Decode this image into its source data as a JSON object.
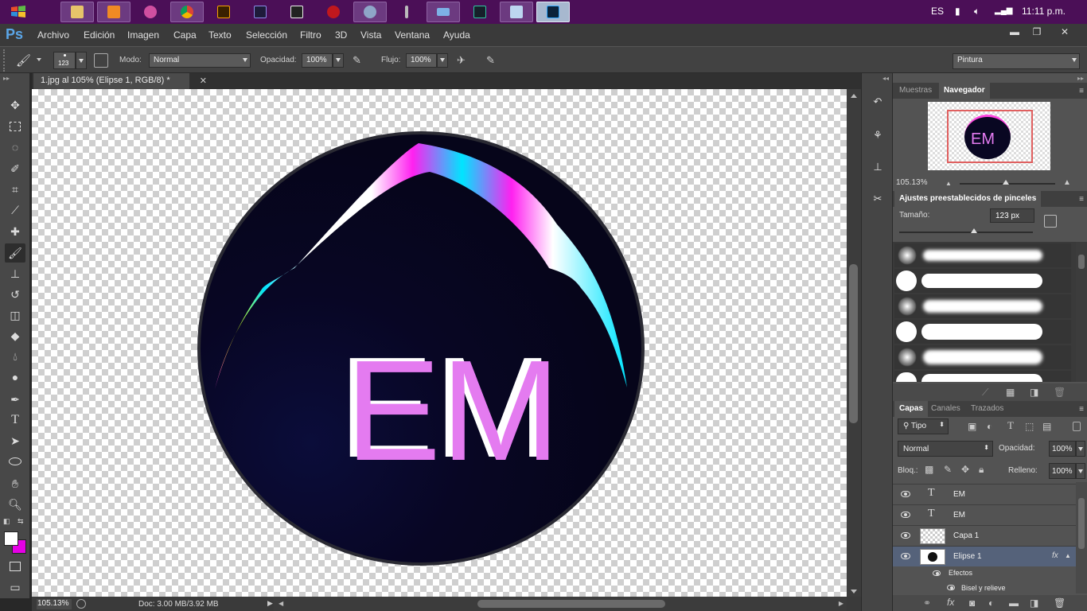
{
  "taskbar": {
    "apps": [
      {
        "name": "file-explorer",
        "active": true
      },
      {
        "name": "media-player",
        "active": true
      },
      {
        "name": "paint-app",
        "active": false
      },
      {
        "name": "chrome",
        "active": true
      },
      {
        "name": "illustrator",
        "active": false
      },
      {
        "name": "premiere",
        "active": false
      },
      {
        "name": "cs-game",
        "active": false
      },
      {
        "name": "music-player",
        "active": false
      },
      {
        "name": "paint-palette",
        "active": true
      },
      {
        "name": "pen-tool-app",
        "active": false
      },
      {
        "name": "keyboard",
        "active": true
      },
      {
        "name": "video-editor",
        "active": false
      },
      {
        "name": "notepad",
        "active": true
      },
      {
        "name": "photoshop",
        "active": true
      }
    ],
    "language": "ES",
    "clock": "11:11 p.m."
  },
  "menubar": {
    "logo": "Ps",
    "items": [
      "Archivo",
      "Edición",
      "Imagen",
      "Capa",
      "Texto",
      "Selección",
      "Filtro",
      "3D",
      "Vista",
      "Ventana",
      "Ayuda"
    ]
  },
  "options": {
    "brush_size": "123",
    "mode_label": "Modo:",
    "mode_value": "Normal",
    "opacity_label": "Opacidad:",
    "opacity_value": "100%",
    "flow_label": "Flujo:",
    "flow_value": "100%",
    "workspace": "Pintura"
  },
  "document": {
    "tab_title": "1.jpg al 105% (Elipse 1, RGB/8) *",
    "logo_text": "EM"
  },
  "status": {
    "zoom": "105.13%",
    "doc_info": "Doc: 3.00 MB/3.92 MB"
  },
  "navigator": {
    "tabs": [
      "Muestras",
      "Navegador"
    ],
    "zoom": "105.13%"
  },
  "brush_presets": {
    "title": "Ajustes preestablecidos de pinceles",
    "size_label": "Tamaño:",
    "size_value": "123 px"
  },
  "layers_panel": {
    "tabs": [
      "Capas",
      "Canales",
      "Trazados"
    ],
    "filter": "Tipo",
    "blend_mode": "Normal",
    "opacity_label": "Opacidad:",
    "opacity_value": "100%",
    "lock_label": "Bloq.:",
    "fill_label": "Relleno:",
    "fill_value": "100%",
    "layers": [
      {
        "name": "EM",
        "type": "text"
      },
      {
        "name": "EM",
        "type": "text"
      },
      {
        "name": "Capa 1",
        "type": "raster"
      },
      {
        "name": "Elipse 1",
        "type": "shape",
        "fx": "fx"
      }
    ],
    "effects_label": "Efectos",
    "effect_item": "Bisel y relieve"
  }
}
